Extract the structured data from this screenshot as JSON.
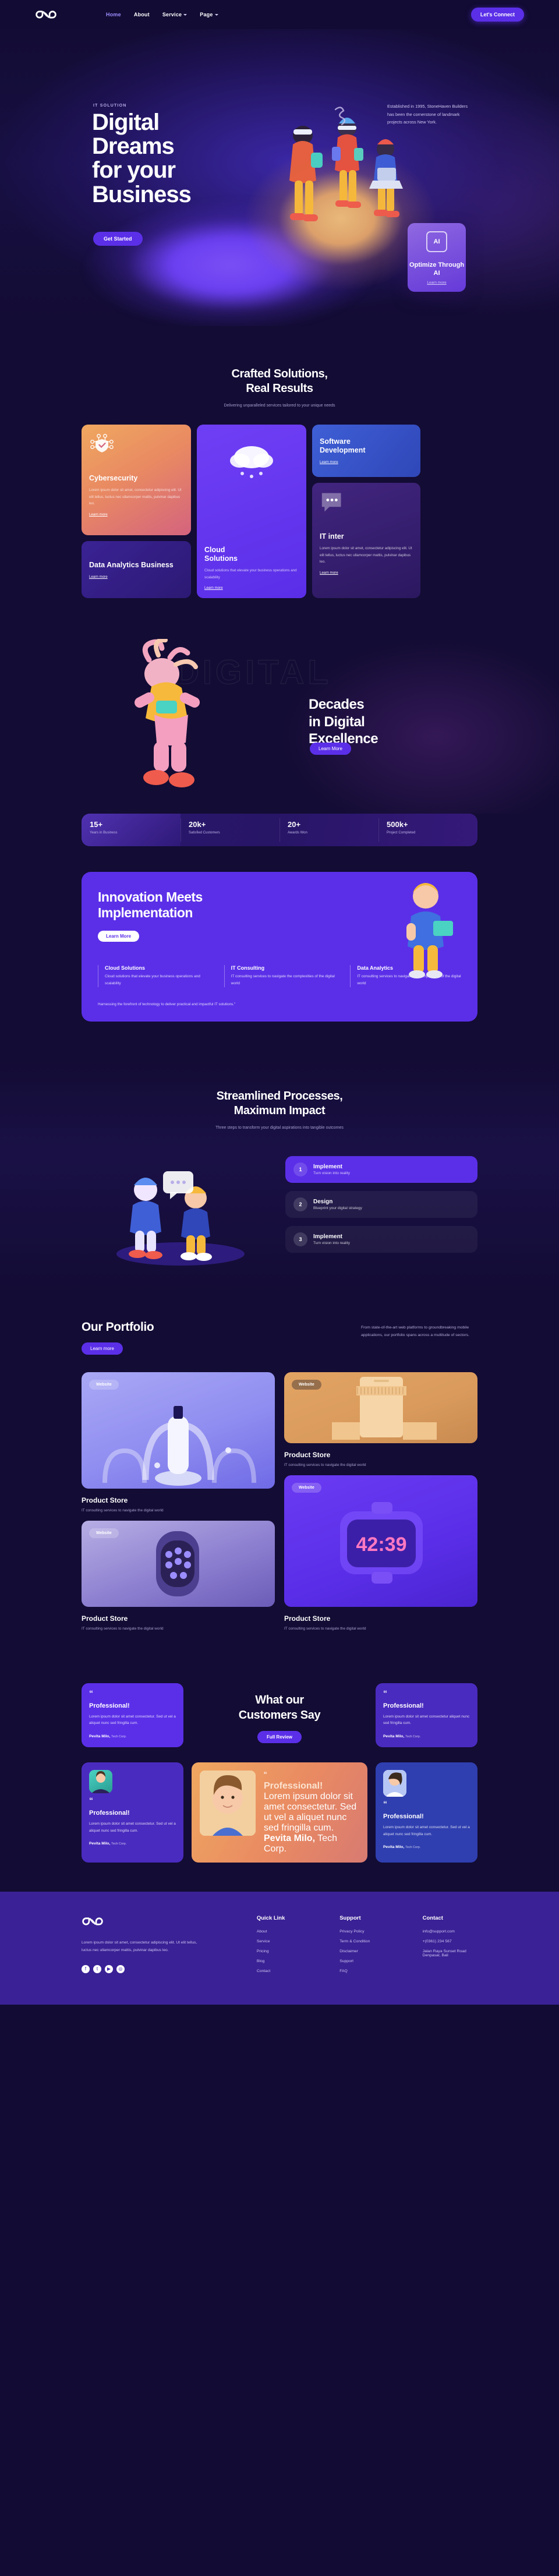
{
  "brand": {
    "name": "infinity-logo"
  },
  "nav": {
    "links": [
      {
        "label": "Home",
        "active": true,
        "caret": false
      },
      {
        "label": "About",
        "active": false,
        "caret": false
      },
      {
        "label": "Service",
        "active": false,
        "caret": true
      },
      {
        "label": "Page",
        "active": false,
        "caret": true
      }
    ],
    "cta": "Let's Connect"
  },
  "hero": {
    "eyebrow": "IT SOLUTION",
    "title_lines": [
      "Digital",
      "Dreams",
      "for your",
      "Business"
    ],
    "button": "Get Started",
    "description": "Established in 1995, StoneHaven Builders has been the cornerstone of landmark projects across New York.",
    "ai_card": {
      "chip": "AI",
      "title": "Optimize Through AI",
      "link": "Learn more"
    }
  },
  "services": {
    "title_line1": "Crafted Solutions,",
    "title_line2": "Real Results",
    "subtitle": "Delivering unparalleled services tailored to your unique needs",
    "cards": {
      "cybersecurity": {
        "title": "Cybersecurity",
        "body": "Lorem ipsum dolor sit amet, consectetur adipiscing elit. Ut elit tellus, luctus nec ullamcorper mattis, pulvinar dapibus leo.",
        "link": "Learn more"
      },
      "data_analytics": {
        "title": "Data Analytics Business",
        "link": "Learn more"
      },
      "cloud": {
        "title_line1": "Cloud",
        "title_line2": "Solutions",
        "body": "Cloud solutions that elevate your business operations and scalability",
        "link": "Learn more"
      },
      "software": {
        "title_line1": "Software",
        "title_line2": "Development",
        "link": "Learn more"
      },
      "it_inter": {
        "title": "IT inter",
        "body": "Lorem ipsum dolor sit amet, consectetur adipiscing elit. Ut elit tellus, luctus nec ullamcorper mattis, pulvinar dapibus leo.",
        "link": "Learn more"
      }
    }
  },
  "decades": {
    "ghost_text": "DIGITAL",
    "title_line1": "Decades",
    "title_line2": "in Digital",
    "title_line3": "Excellence",
    "button": "Learn More"
  },
  "stats": [
    {
      "number": "15+",
      "label": "Years in Business"
    },
    {
      "number": "20k+",
      "label": "Satisfied Customers"
    },
    {
      "number": "20+",
      "label": "Awards Won"
    },
    {
      "number": "500k+",
      "label": "Project Completed"
    }
  ],
  "innovation": {
    "title_line1": "Innovation Meets",
    "title_line2": "Implementation",
    "button": "Learn More",
    "columns": [
      {
        "title": "Cloud Solutions",
        "body": "Cloud solutions that elevate your business operations and scalability"
      },
      {
        "title": "IT Consulting",
        "body": "IT consulting services to navigate the complexities of the digital world"
      },
      {
        "title": "Data Analytics",
        "body": "IT consulting services to navigate the complexities of the digital world"
      }
    ],
    "footer_note": "Harnessing the forefront of technology to deliver practical and impactful IT solutions.\""
  },
  "process": {
    "title_line1": "Streamlined Processes,",
    "title_line2": "Maximum Impact",
    "subtitle": "Three steps to transform your digital aspirations into tangible outcomes",
    "steps": [
      {
        "number": "1",
        "title": "Implement",
        "body": "Turn vision into reality",
        "active": true
      },
      {
        "number": "2",
        "title": "Design",
        "body": "Blueprint your digital strategy",
        "active": false
      },
      {
        "number": "3",
        "title": "Implement",
        "body": "Turn vision into reality",
        "active": false
      }
    ]
  },
  "portfolio": {
    "title": "Our Portfolio",
    "button": "Learn more",
    "description": "From state-of-the-art web platforms to groundbreaking mobile applications, our portfolio spans across a multitude of sectors.",
    "items": [
      {
        "tag": "Website",
        "title": "Product Store",
        "body": "IT consulting services to navigate the digital world"
      },
      {
        "tag": "Website",
        "title": "Product Store",
        "body": "IT consulting services to navigate the digital world"
      },
      {
        "tag": "Website",
        "title": "Product Store",
        "body": "IT consulting services to navigate the digital world"
      },
      {
        "tag": "Website",
        "title": "Product Store",
        "body": "IT consulting services to navigate the digital world"
      }
    ]
  },
  "testimonials": {
    "title_line1": "What our",
    "title_line2": "Customers Say",
    "button": "Full Review",
    "quote_mark": "“",
    "cards": [
      {
        "heading": "Professional!",
        "body": "Lorem ipsum dolor sit amet consectetur. Sed ut vel a aliquet nunc sed fringilla cum.",
        "author": "Pevita Milo,",
        "company": "Tech Corp."
      },
      {
        "heading": "Professional!",
        "body": "Lorem ipsum dolor sit amet consectetur aliquet nunc sed fringilla cum.",
        "author": "Pevita Milo,",
        "company": "Tech Corp."
      },
      {
        "heading": "Professional!",
        "body": "Lorem ipsum dolor sit amet consectetur. Sed ut vel a aliquet nunc sed fringilla cum.",
        "author": "Pevita Milo,",
        "company": "Tech Corp."
      },
      {
        "heading": "Professional!",
        "body": "Lorem ipsum dolor sit amet consectetur. Sed ut vel a aliquet nunc sed fringilla cum.",
        "author": "Pevita Milo,",
        "company": "Tech Corp."
      },
      {
        "heading": "Professional!",
        "body": "Lorem ipsum dolor sit amet consectetur. Sed ut vel a aliquet nunc sed fringilla cum.",
        "author": "Pevita Milo,",
        "company": "Tech Corp."
      }
    ]
  },
  "footer": {
    "about": "Lorem ipsum dolor sit amet, consectetur adipiscing elit. Ut elit tellus, luctus nec ullamcorper mattis, pulvinar dapibus leo.",
    "socials": [
      "facebook-icon",
      "twitter-icon",
      "youtube-icon",
      "instagram-icon"
    ],
    "quick_link": {
      "title": "Quick Link",
      "items": [
        "About",
        "Service",
        "Pricing",
        "Blog",
        "Contact"
      ]
    },
    "support": {
      "title": "Support",
      "items": [
        "Privacy Policy",
        "Term & Condition",
        "Disclaimer",
        "Support",
        "FAQ"
      ]
    },
    "contact": {
      "title": "Contact",
      "items": [
        "info@support.com",
        "+(0361) 234 567",
        "Jalan Raya Sunset Road Denpasar, Bali"
      ]
    }
  },
  "colors": {
    "accent": "#5b2fe8",
    "bg": "#130c34",
    "footer_bg": "#3a2195"
  }
}
